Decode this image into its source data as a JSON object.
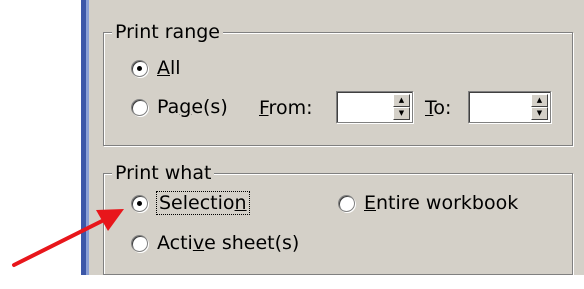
{
  "print_range": {
    "legend": "Print range",
    "all": {
      "pre": "",
      "key": "A",
      "post": "ll"
    },
    "pages": {
      "pre": "Pa",
      "key": "g",
      "post": "e(s)"
    },
    "from": {
      "pre": "",
      "key": "F",
      "post": "rom:"
    },
    "to": {
      "pre": "",
      "key": "T",
      "post": "o:"
    },
    "from_value": "",
    "to_value": ""
  },
  "print_what": {
    "legend": "Print what",
    "selection": {
      "pre": "Selectio",
      "key": "n",
      "post": ""
    },
    "entire_workbook": {
      "pre": "",
      "key": "E",
      "post": "ntire workbook"
    },
    "active_sheets": {
      "pre": "Acti",
      "key": "v",
      "post": "e sheet(s)"
    }
  },
  "colors": {
    "dialog_bg": "#d4d0c8",
    "arrow": "#e8161b"
  }
}
